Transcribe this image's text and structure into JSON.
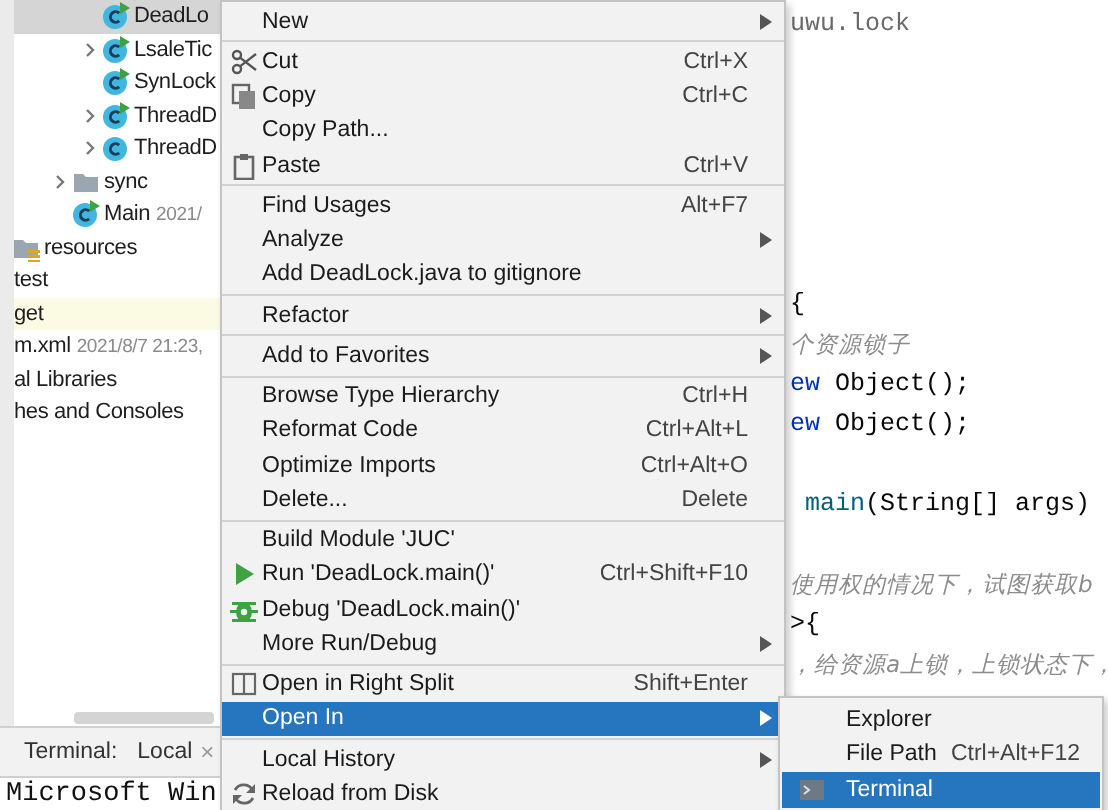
{
  "project_tree": {
    "items": [
      {
        "children": [
          {
            "children": [
              {
                "children": [
                  {
                    "children": [
                      {
                        "label": "DeadLo",
                        "kind": "class",
                        "runnable": true,
                        "selected": true
                      },
                      {
                        "label": "LsaleTic",
                        "kind": "class",
                        "runnable": true,
                        "expanded": false,
                        "selected": false
                      },
                      {
                        "label": "SynLock",
                        "kind": "class",
                        "runnable": true,
                        "selected": false
                      },
                      {
                        "label": "ThreadD",
                        "kind": "class",
                        "runnable": true,
                        "expanded": false,
                        "selected": false
                      },
                      {
                        "label": "ThreadD",
                        "kind": "class",
                        "runnable": false,
                        "expanded": false,
                        "selected": false
                      }
                    ]
                  },
                  {
                    "label": "sync",
                    "kind": "folder",
                    "expanded": false,
                    "selected": false
                  },
                  {
                    "label": "Main",
                    "kind": "class",
                    "runnable": true,
                    "meta": "2021/",
                    "selected": false
                  }
                ]
              }
            ]
          },
          {
            "label": "resources",
            "kind": "resource_folder",
            "selected": false
          }
        ]
      },
      {
        "label": "test",
        "selected": false
      },
      {
        "label": "get",
        "excluded": true,
        "selected": false
      },
      {
        "label": "m.xml",
        "meta": "2021/8/7 21:23,",
        "selected": false
      },
      {
        "label": "al Libraries",
        "selected": false
      },
      {
        "label": "hes and Consoles",
        "selected": false
      }
    ]
  },
  "editor": {
    "lines": [
      {
        "kind": "code",
        "tokens": [
          {
            "text": "uwu.lock",
            "kind": "package"
          }
        ]
      },
      {
        "kind": "blank"
      },
      {
        "kind": "blank"
      },
      {
        "kind": "blank"
      },
      {
        "kind": "blank"
      },
      {
        "kind": "blank"
      },
      {
        "kind": "blank"
      },
      {
        "kind": "code",
        "tokens": [
          {
            "text": "{",
            "kind": "plain"
          }
        ]
      },
      {
        "kind": "code",
        "tokens": [
          {
            "text": "个资源锁子",
            "kind": "comment"
          }
        ]
      },
      {
        "kind": "code",
        "tokens": [
          {
            "text": "ew",
            "kind": "keyword"
          },
          {
            "text": " Object();",
            "kind": "plain"
          }
        ]
      },
      {
        "kind": "code",
        "tokens": [
          {
            "text": "ew",
            "kind": "keyword"
          },
          {
            "text": " Object();",
            "kind": "plain"
          }
        ]
      },
      {
        "kind": "blank"
      },
      {
        "kind": "code",
        "tokens": [
          {
            "text": " main",
            "kind": "method"
          },
          {
            "text": "(String[] args)",
            "kind": "plain"
          }
        ]
      },
      {
        "kind": "blank"
      },
      {
        "kind": "code",
        "tokens": [
          {
            "text": "使用权的情况下，试图获取b",
            "kind": "comment"
          }
        ]
      },
      {
        "kind": "code",
        "tokens": [
          {
            "text": ">{",
            "kind": "plain"
          }
        ]
      },
      {
        "kind": "code",
        "tokens": [
          {
            "text": "，给资源a上锁，上锁状态下，",
            "kind": "comment"
          }
        ]
      }
    ]
  },
  "terminal": {
    "title": "Terminal:",
    "tab": "Local",
    "close": "×",
    "output": "Microsoft Win"
  },
  "menu": {
    "items": [
      {
        "kind": "item",
        "label": "New",
        "submenu": true,
        "selected": false
      },
      {
        "kind": "separator"
      },
      {
        "kind": "cut",
        "label": "Cut",
        "shortcut": "Ctrl+X",
        "submenu": false,
        "selected": false
      },
      {
        "kind": "copy",
        "label": "Copy",
        "shortcut": "Ctrl+C",
        "submenu": false,
        "selected": false
      },
      {
        "kind": "item",
        "label": "Copy Path...",
        "submenu": false,
        "selected": false
      },
      {
        "kind": "paste",
        "label": "Paste",
        "shortcut": "Ctrl+V",
        "submenu": false,
        "selected": false
      },
      {
        "kind": "separator"
      },
      {
        "kind": "item",
        "label": "Find Usages",
        "shortcut": "Alt+F7",
        "submenu": false,
        "selected": false
      },
      {
        "kind": "item",
        "label": "Analyze",
        "submenu": true,
        "selected": false
      },
      {
        "kind": "item",
        "label": "Add DeadLock.java to gitignore",
        "submenu": false,
        "selected": false
      },
      {
        "kind": "separator"
      },
      {
        "kind": "item",
        "label": "Refactor",
        "submenu": true,
        "selected": false
      },
      {
        "kind": "separator"
      },
      {
        "kind": "item",
        "label": "Add to Favorites",
        "submenu": true,
        "selected": false
      },
      {
        "kind": "separator"
      },
      {
        "kind": "item",
        "label": "Browse Type Hierarchy",
        "shortcut": "Ctrl+H",
        "submenu": false,
        "selected": false
      },
      {
        "kind": "item",
        "label": "Reformat Code",
        "shortcut": "Ctrl+Alt+L",
        "submenu": false,
        "selected": false
      },
      {
        "kind": "item",
        "label": "Optimize Imports",
        "shortcut": "Ctrl+Alt+O",
        "submenu": false,
        "selected": false
      },
      {
        "kind": "item",
        "label": "Delete...",
        "shortcut": "Delete",
        "submenu": false,
        "selected": false
      },
      {
        "kind": "separator"
      },
      {
        "kind": "item",
        "label": "Build Module 'JUC'",
        "submenu": false,
        "selected": false
      },
      {
        "kind": "run",
        "label": "Run 'DeadLock.main()'",
        "shortcut": "Ctrl+Shift+F10",
        "submenu": false,
        "selected": false
      },
      {
        "kind": "debug",
        "label": "Debug 'DeadLock.main()'",
        "submenu": false,
        "selected": false
      },
      {
        "kind": "item",
        "label": "More Run/Debug",
        "submenu": true,
        "selected": false
      },
      {
        "kind": "separator"
      },
      {
        "kind": "split",
        "label": "Open in Right Split",
        "shortcut": "Shift+Enter",
        "submenu": false,
        "selected": false
      },
      {
        "kind": "item",
        "label": "Open In",
        "submenu": true,
        "selected": true
      },
      {
        "kind": "separator"
      },
      {
        "kind": "item",
        "label": "Local History",
        "submenu": true,
        "selected": false
      },
      {
        "kind": "reload",
        "label": "Reload from Disk",
        "submenu": false,
        "selected": false
      }
    ]
  },
  "submenu": {
    "items": [
      {
        "kind": "item",
        "label": "Explorer",
        "selected": false
      },
      {
        "kind": "item",
        "label": "File Path",
        "shortcut": "Ctrl+Alt+F12",
        "selected": false
      },
      {
        "kind": "terminal",
        "label": "Terminal",
        "selected": true
      }
    ]
  }
}
